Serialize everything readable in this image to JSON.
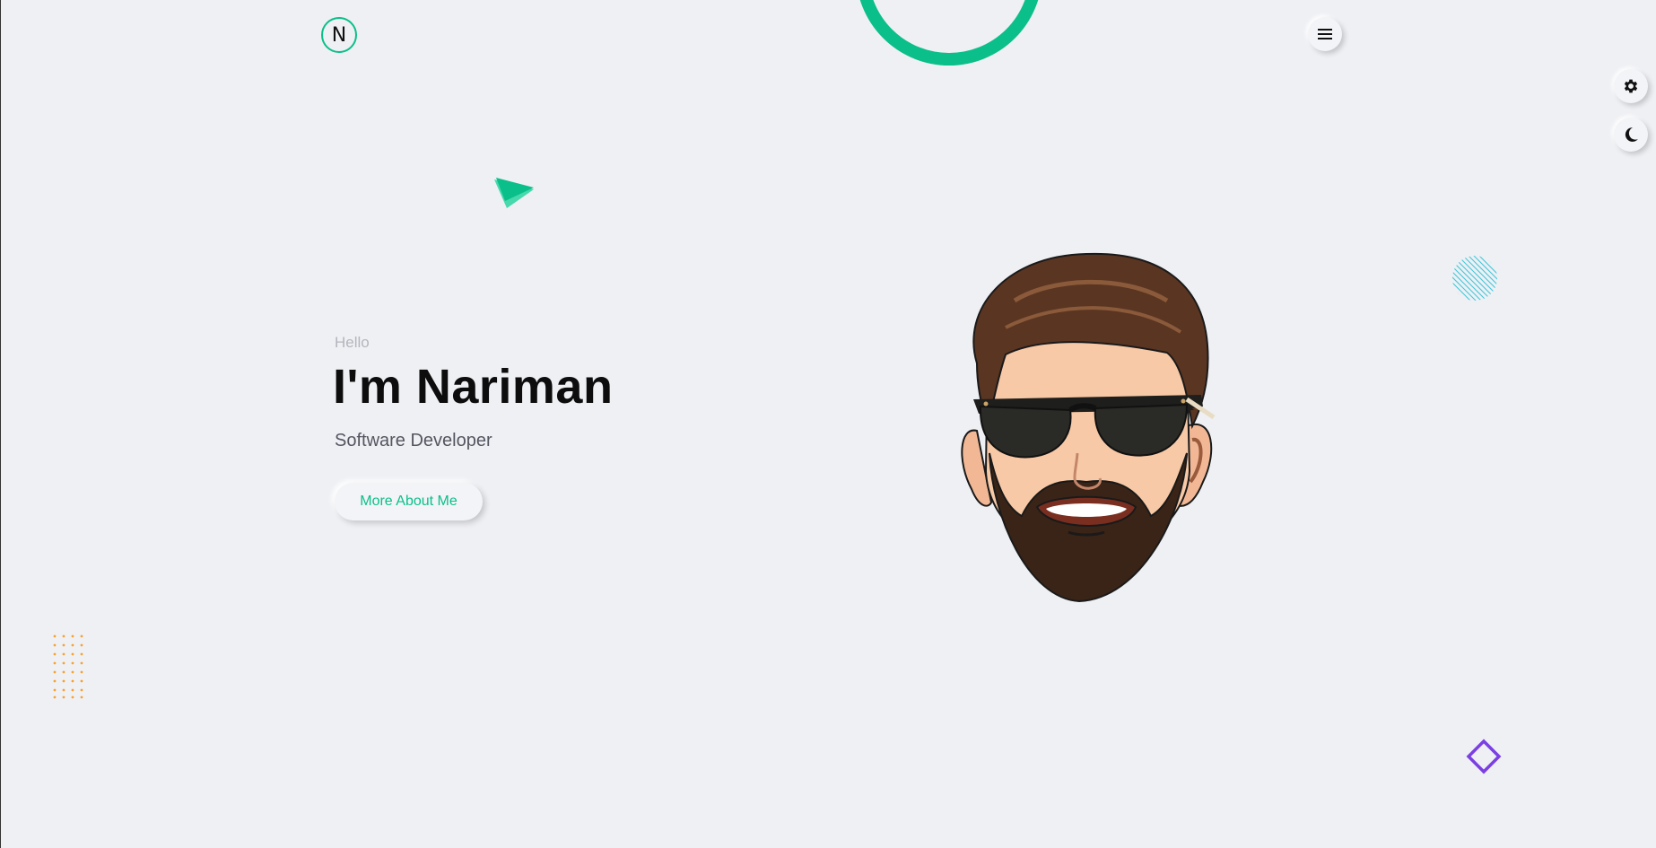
{
  "header": {
    "logo_letter": "N"
  },
  "hero": {
    "greeting": "Hello",
    "name": "I'm Nariman",
    "role": "Software Developer",
    "cta_label": "More About Me"
  },
  "icons": {
    "menu": "hamburger-menu-icon",
    "settings": "gear-icon",
    "theme": "moon-icon"
  },
  "colors": {
    "accent": "#0bbf8a",
    "background": "#eff0f4",
    "dots": "#f7a232",
    "diamond": "#7b3fe4",
    "stripes": "#3cc7d8"
  }
}
